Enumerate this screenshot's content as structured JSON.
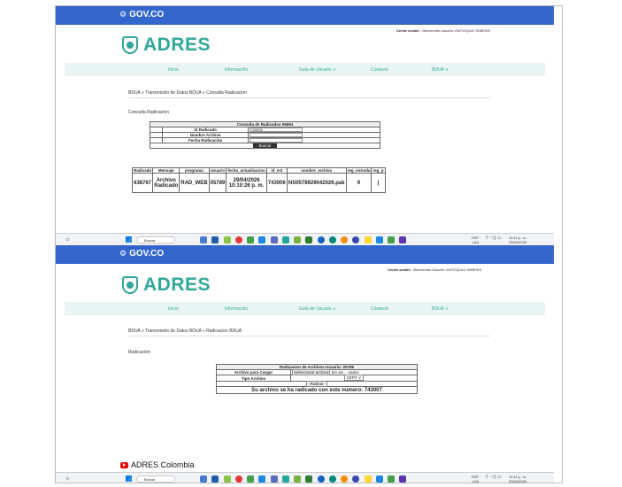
{
  "gov_label": "GOV.CO",
  "brand": "ADRES",
  "session": {
    "logout": "Cerrar sesión",
    "welcome": "- Bienvenido Usuario: ANTIOQUIA TAMESIS"
  },
  "nav": {
    "items": [
      "Inicio",
      "Información",
      "Guía de Usuario ∨",
      "Contacto",
      "BDUA ∨"
    ]
  },
  "top": {
    "breadcrumb": "BDUA » Transmisión de Datos BDUA » Consulta Radicacion",
    "section": "Consulta Radicación",
    "form": {
      "title": "Consulta de Radicados 06694",
      "id_label": "Id Radicado",
      "id_value": "743006",
      "name_label": "Nombre Archivo",
      "name_value": "",
      "date_label": "Fecha Radicación",
      "date_value": "",
      "button": "Buscar"
    },
    "results": {
      "headers": [
        "Radicado",
        "Mensaje",
        "programa",
        "usuario",
        "fecha_actualizacion",
        "id_est",
        "nombre_archivo",
        "reg_entrada",
        "reg_p"
      ],
      "row": [
        "638767",
        "Archivo Radicado",
        "RAD_WEB",
        "05789",
        "29/04/2026 10:10:26 p. m.",
        "743006",
        "NS0578929042026.pak",
        "9",
        "("
      ]
    }
  },
  "bottom": {
    "breadcrumb": "BDUA » Transmisión de Datos BDUA » Radicacion BDUA",
    "section": "Radicación",
    "form": {
      "title": "Radicacion de Archivos Usuario: 05789",
      "file_label": "Archivo para Cargar",
      "file_button": "Seleccionar archivo",
      "file_status": "Sin arc... nados",
      "type_label": "Tipo Archivo",
      "type_value": "CERT ∨",
      "submit": "Radicar",
      "message": "Su archivo se ha radicado con este numero: 743007"
    }
  },
  "taskbar": {
    "search": "Buscar",
    "lang": "ESP",
    "region": "LAA",
    "time_top": "10:12 p. m.",
    "date_top": "29/04/2026",
    "time_bottom": "10:12 p. m.",
    "date_bottom": "29/04/2026"
  },
  "footer_channel": "ADRES Colombia",
  "colors": {
    "gov_blue": "#3366cc",
    "brand_teal": "#2fa79a"
  }
}
